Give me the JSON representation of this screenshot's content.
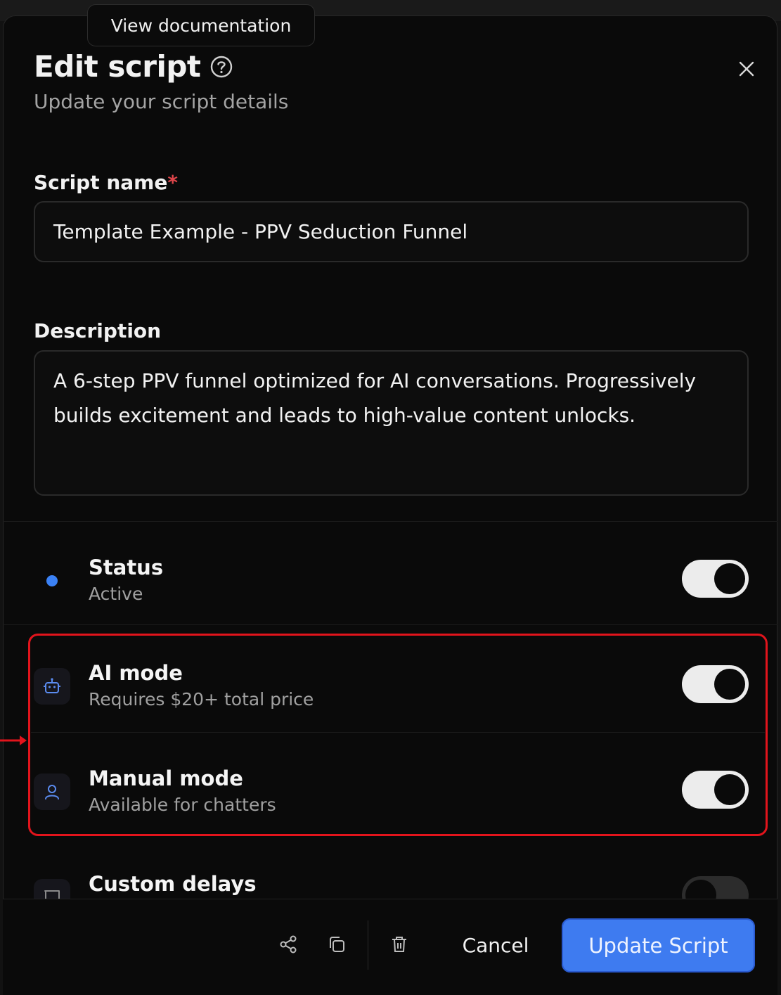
{
  "tooltip": {
    "text": "View documentation"
  },
  "header": {
    "title": "Edit script",
    "subtitle": "Update your script details"
  },
  "form": {
    "name_label": "Script name",
    "required_mark": "*",
    "name_value": "Template Example - PPV Seduction Funnel",
    "description_label": "Description",
    "description_value": "A 6-step PPV funnel optimized for AI conversations. Progressively builds excitement and leads to high-value content unlocks."
  },
  "settings": {
    "status": {
      "title": "Status",
      "subtitle": "Active",
      "enabled": true
    },
    "ai_mode": {
      "title": "AI mode",
      "subtitle": "Requires $20+ total price",
      "enabled": true
    },
    "manual_mode": {
      "title": "Manual mode",
      "subtitle": "Available for chatters",
      "enabled": true
    },
    "custom_delays": {
      "title": "Custom delays",
      "enabled": false
    }
  },
  "footer": {
    "cancel_label": "Cancel",
    "submit_label": "Update Script"
  },
  "colors": {
    "accent": "#3e7bf0",
    "status_dot": "#3b82f6",
    "highlight": "#e2141c"
  }
}
